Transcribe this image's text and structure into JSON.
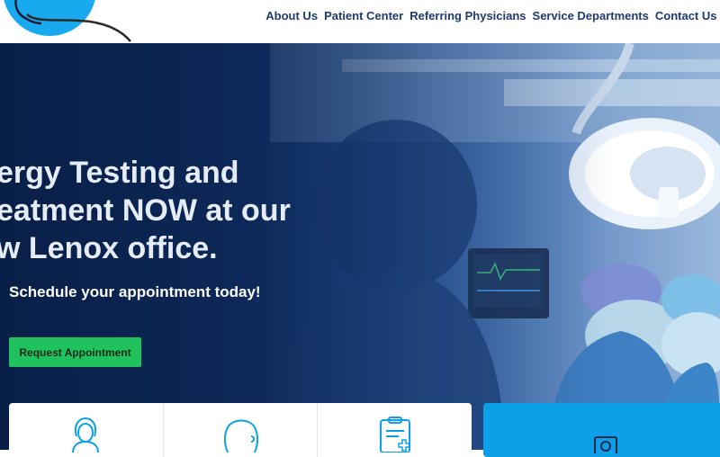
{
  "nav": {
    "items": [
      "About Us",
      "Patient Center",
      "Referring Physicians",
      "Service Departments",
      "Contact Us"
    ]
  },
  "hero": {
    "headline_lines": [
      "ergy Testing and",
      "eatment NOW at our",
      "w Lenox office."
    ],
    "subheading": "Schedule your appointment today!",
    "cta_label": "Request Appointment"
  },
  "cards": {
    "icons": [
      "female-patient-icon",
      "head-profile-icon",
      "clipboard-medical-icon"
    ],
    "highlight_icon": "document-icon"
  },
  "colors": {
    "nav_text": "#1e3a6e",
    "cta": "#1fc25c",
    "accent_blue": "#0da0e8",
    "logo_blue": "#18a9ee"
  }
}
